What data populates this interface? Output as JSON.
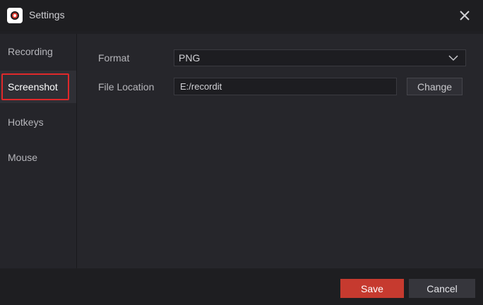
{
  "window": {
    "title": "Settings"
  },
  "sidebar": {
    "items": [
      {
        "label": "Recording",
        "active": false
      },
      {
        "label": "Screenshot",
        "active": true
      },
      {
        "label": "Hotkeys",
        "active": false
      },
      {
        "label": "Mouse",
        "active": false
      }
    ]
  },
  "screenshot": {
    "format_label": "Format",
    "format_value": "PNG",
    "location_label": "File Location",
    "location_value": "E:/recordit",
    "change_label": "Change"
  },
  "footer": {
    "save_label": "Save",
    "cancel_label": "Cancel"
  },
  "colors": {
    "accent": "#c63a2f",
    "highlight": "#e0282a",
    "background": "#1f1f23"
  },
  "icons": {
    "app": "recordit-logo-icon",
    "close": "close-icon",
    "dropdown": "chevron-down-icon"
  }
}
